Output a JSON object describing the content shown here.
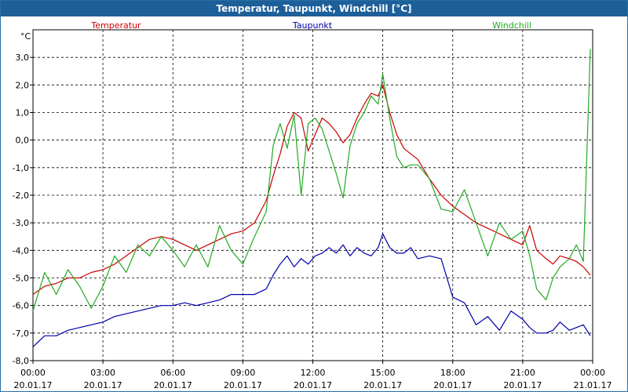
{
  "window": {
    "title": "Temperatur, Taupunkt, Windchill [°C]"
  },
  "chart_data": {
    "type": "line",
    "title": "Temperatur, Taupunkt, Windchill [°C]",
    "ylabel": "°C",
    "ylim": [
      -8,
      4
    ],
    "yticks": [
      -8,
      -7,
      -6,
      -5,
      -4,
      -3,
      -2,
      -1,
      0,
      1,
      2,
      3
    ],
    "ytick_labels": [
      "-8,0",
      "-7,0",
      "-6,0",
      "-5,0",
      "-4,0",
      "-3,0",
      "-2,0",
      "-1,0",
      "0,0",
      "1,0",
      "2,0",
      "3,0"
    ],
    "xlim": [
      0,
      24
    ],
    "xticks": [
      0,
      3,
      6,
      9,
      12,
      15,
      18,
      21,
      24
    ],
    "xtick_time": [
      "00:00",
      "03:00",
      "06:00",
      "09:00",
      "12:00",
      "15:00",
      "18:00",
      "21:00",
      "00:00"
    ],
    "xtick_date": [
      "20.01.17",
      "20.01.17",
      "20.01.17",
      "20.01.17",
      "20.01.17",
      "20.01.17",
      "20.01.17",
      "20.01.17",
      "21.01.17"
    ],
    "grid": true,
    "legend_position": "top",
    "x": [
      0.0,
      0.5,
      1.0,
      1.5,
      2.0,
      2.5,
      3.0,
      3.5,
      4.0,
      4.5,
      5.0,
      5.5,
      6.0,
      6.5,
      7.0,
      7.5,
      8.0,
      8.5,
      9.0,
      9.5,
      10.0,
      10.3,
      10.6,
      10.9,
      11.2,
      11.5,
      11.8,
      12.1,
      12.4,
      12.7,
      13.0,
      13.3,
      13.6,
      13.9,
      14.2,
      14.5,
      14.8,
      15.0,
      15.3,
      15.6,
      15.9,
      16.2,
      16.5,
      17.0,
      17.5,
      18.0,
      18.5,
      19.0,
      19.5,
      20.0,
      20.5,
      21.0,
      21.3,
      21.6,
      22.0,
      22.3,
      22.6,
      23.0,
      23.3,
      23.6,
      23.9
    ],
    "series": [
      {
        "name": "Temperatur",
        "color": "#cc0000",
        "values": [
          -5.6,
          -5.3,
          -5.2,
          -5.0,
          -5.0,
          -4.8,
          -4.7,
          -4.5,
          -4.2,
          -3.9,
          -3.6,
          -3.5,
          -3.6,
          -3.8,
          -4.0,
          -3.8,
          -3.6,
          -3.4,
          -3.3,
          -3.0,
          -2.2,
          -1.3,
          -0.5,
          0.5,
          1.0,
          0.8,
          -0.4,
          0.2,
          0.8,
          0.6,
          0.3,
          -0.1,
          0.2,
          0.8,
          1.3,
          1.7,
          1.6,
          2.0,
          1.0,
          0.2,
          -0.3,
          -0.5,
          -0.7,
          -1.4,
          -2.0,
          -2.4,
          -2.7,
          -3.0,
          -3.2,
          -3.4,
          -3.6,
          -3.8,
          -3.1,
          -4.0,
          -4.3,
          -4.5,
          -4.2,
          -4.3,
          -4.4,
          -4.6,
          -4.9
        ]
      },
      {
        "name": "Taupunkt",
        "color": "#0000aa",
        "values": [
          -7.5,
          -7.1,
          -7.1,
          -6.9,
          -6.8,
          -6.7,
          -6.6,
          -6.4,
          -6.3,
          -6.2,
          -6.1,
          -6.0,
          -6.0,
          -5.9,
          -6.0,
          -5.9,
          -5.8,
          -5.6,
          -5.6,
          -5.6,
          -5.4,
          -4.9,
          -4.5,
          -4.2,
          -4.6,
          -4.3,
          -4.5,
          -4.2,
          -4.1,
          -3.9,
          -4.1,
          -3.8,
          -4.2,
          -3.9,
          -4.1,
          -4.2,
          -3.9,
          -3.4,
          -3.9,
          -4.1,
          -4.1,
          -3.9,
          -4.3,
          -4.2,
          -4.3,
          -5.7,
          -5.9,
          -6.7,
          -6.4,
          -6.9,
          -6.2,
          -6.5,
          -6.8,
          -7.0,
          -7.0,
          -6.9,
          -6.6,
          -6.9,
          -6.8,
          -6.7,
          -7.1
        ]
      },
      {
        "name": "Windchill",
        "color": "#22aa22",
        "values": [
          -6.2,
          -4.8,
          -5.6,
          -4.7,
          -5.3,
          -6.1,
          -5.3,
          -4.2,
          -4.8,
          -3.8,
          -4.2,
          -3.5,
          -4.0,
          -4.6,
          -3.8,
          -4.6,
          -3.1,
          -4.0,
          -4.5,
          -3.5,
          -2.6,
          -0.2,
          0.6,
          -0.3,
          0.9,
          -2.0,
          0.6,
          0.8,
          0.4,
          -0.4,
          -1.2,
          -2.1,
          -0.2,
          0.6,
          1.0,
          1.6,
          1.3,
          2.4,
          0.8,
          -0.6,
          -1.0,
          -0.9,
          -0.9,
          -1.4,
          -2.5,
          -2.6,
          -1.8,
          -3.0,
          -4.2,
          -3.0,
          -3.6,
          -3.3,
          -4.2,
          -5.4,
          -5.8,
          -5.0,
          -4.6,
          -4.3,
          -3.8,
          -4.4,
          3.3
        ]
      }
    ]
  }
}
